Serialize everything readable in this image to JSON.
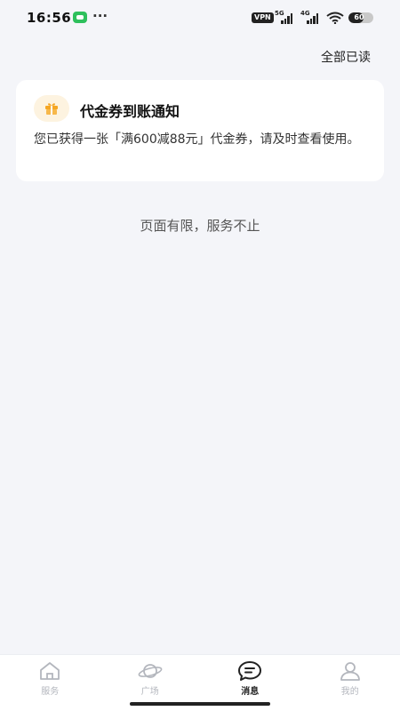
{
  "status_bar": {
    "time": "16:56",
    "dots": "···",
    "vpn": "VPN",
    "net1": "5G",
    "net2": "4G",
    "battery": "60",
    "battery_level": 60
  },
  "header": {
    "mark_all_read": "全部已读"
  },
  "notification": {
    "icon": "gift-icon",
    "title": "代金券到账通知",
    "body": "您已获得一张「满600减88元」代金券，请及时查看使用。"
  },
  "footer_note": "页面有限，服务不止",
  "tabs": [
    {
      "label": "服务",
      "icon": "home-icon",
      "active": false
    },
    {
      "label": "广场",
      "icon": "planet-icon",
      "active": false
    },
    {
      "label": "消息",
      "icon": "message-icon",
      "active": true
    },
    {
      "label": "我的",
      "icon": "user-icon",
      "active": false
    }
  ],
  "colors": {
    "background": "#f4f5f9",
    "card": "#ffffff",
    "gift_accent": "#f5a623",
    "tab_active": "#222222",
    "tab_inactive": "#b3b6bd"
  }
}
